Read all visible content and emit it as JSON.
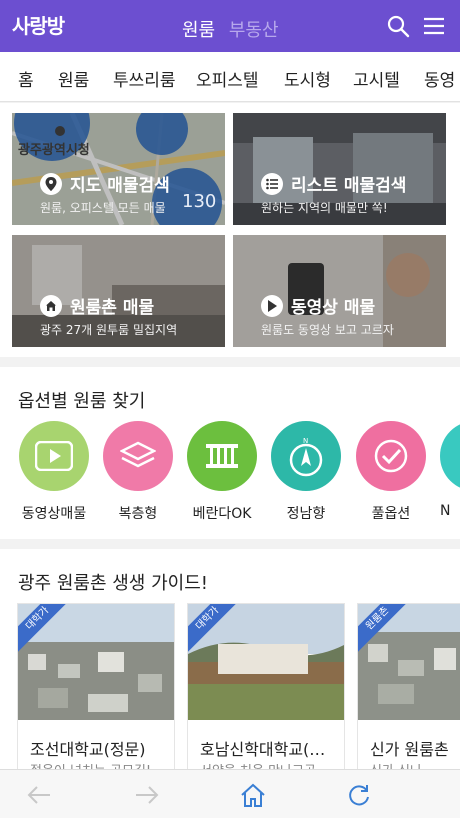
{
  "header": {
    "logo": "사랑방",
    "tab_active": "원룸",
    "tab_inactive": "부동산",
    "icons": [
      "search-icon",
      "menu-icon"
    ],
    "brand_color": "#6c4fd0"
  },
  "nav": {
    "items": [
      "홈",
      "원룸",
      "투쓰리룸",
      "오피스텔",
      "도시형",
      "고시텔",
      "동영"
    ]
  },
  "cards": [
    {
      "title": "지도 매물검색",
      "subtitle": "원룸, 오피스텔 모든 매물",
      "icon": "map-pin-icon",
      "map_label": "광주광역시청",
      "map_count": "130"
    },
    {
      "title": "리스트 매물검색",
      "subtitle": "원하는 지역의 매물만 쏙!",
      "icon": "list-icon"
    },
    {
      "title": "원룸촌 매물",
      "subtitle": "광주 27개 원투룸 밀집지역",
      "icon": "home-icon"
    },
    {
      "title": "동영상 매물",
      "subtitle": "원룸도 동영상 보고 고르자",
      "icon": "play-icon"
    }
  ],
  "options": {
    "title": "옵션별 원룸 찾기",
    "items": [
      {
        "label": "동영상매물",
        "color": "#a8d46f",
        "icon": "video-icon"
      },
      {
        "label": "복층형",
        "color": "#f07aa8",
        "icon": "layers-icon"
      },
      {
        "label": "베란다OK",
        "color": "#6cbf3e",
        "icon": "balcony-icon"
      },
      {
        "label": "정남향",
        "color": "#2db8a8",
        "icon": "compass-icon"
      },
      {
        "label": "풀옵션",
        "color": "#ef6fa0",
        "icon": "check-icon"
      },
      {
        "label": "N",
        "color": "#39c9c0",
        "icon": "partial-icon"
      }
    ]
  },
  "guide": {
    "title": "광주 원룸촌 생생 가이드!",
    "cards": [
      {
        "ribbon": "대학가",
        "title": "조선대학교(정문)",
        "subtitle": "젊음이 넘치는 곳묘길!"
      },
      {
        "ribbon": "대학가",
        "title": "호남신학대학교(…",
        "subtitle": "서양을 처음 만나고곳"
      },
      {
        "ribbon": "원룸촌",
        "title": "신가 원룸촌",
        "subtitle": "신가 신나"
      }
    ]
  },
  "bottom": {
    "icons": [
      "back-arrow-icon",
      "forward-arrow-icon",
      "home-icon",
      "refresh-icon"
    ]
  }
}
